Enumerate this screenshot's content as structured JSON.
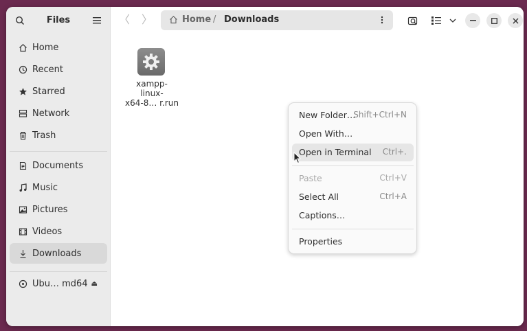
{
  "sidebar": {
    "title": "Files",
    "places": [
      {
        "label": "Home",
        "icon": "home-icon"
      },
      {
        "label": "Recent",
        "icon": "clock-icon"
      },
      {
        "label": "Starred",
        "icon": "star-icon"
      },
      {
        "label": "Network",
        "icon": "network-icon"
      },
      {
        "label": "Trash",
        "icon": "trash-icon"
      }
    ],
    "bookmarks": [
      {
        "label": "Documents",
        "icon": "document-icon"
      },
      {
        "label": "Music",
        "icon": "music-icon"
      },
      {
        "label": "Pictures",
        "icon": "picture-icon"
      },
      {
        "label": "Videos",
        "icon": "video-icon"
      },
      {
        "label": "Downloads",
        "icon": "download-icon",
        "active": true
      }
    ],
    "devices": [
      {
        "label": "Ubu… md64",
        "icon": "disc-icon"
      }
    ]
  },
  "toolbar": {
    "path_home": "Home",
    "path_separator": "/",
    "path_current": "Downloads"
  },
  "files": [
    {
      "name": "xampp-\nlinux-\nx64-8… r.run",
      "icon": "gear-icon"
    }
  ],
  "context_menu": {
    "items": [
      {
        "label": "New Folder…",
        "shortcut": "Shift+Ctrl+N"
      },
      {
        "label": "Open With…",
        "shortcut": ""
      },
      {
        "label": "Open in Terminal",
        "shortcut": "Ctrl+."
      },
      {
        "label": "Paste",
        "shortcut": "Ctrl+V",
        "disabled": true
      },
      {
        "label": "Select All",
        "shortcut": "Ctrl+A"
      },
      {
        "label": "Captions…",
        "shortcut": ""
      },
      {
        "label": "Properties",
        "shortcut": ""
      }
    ]
  },
  "colors": {
    "desktop": "#6b2a4f",
    "sidebar_bg": "#ebebeb",
    "active_item": "#d9d9d9"
  }
}
